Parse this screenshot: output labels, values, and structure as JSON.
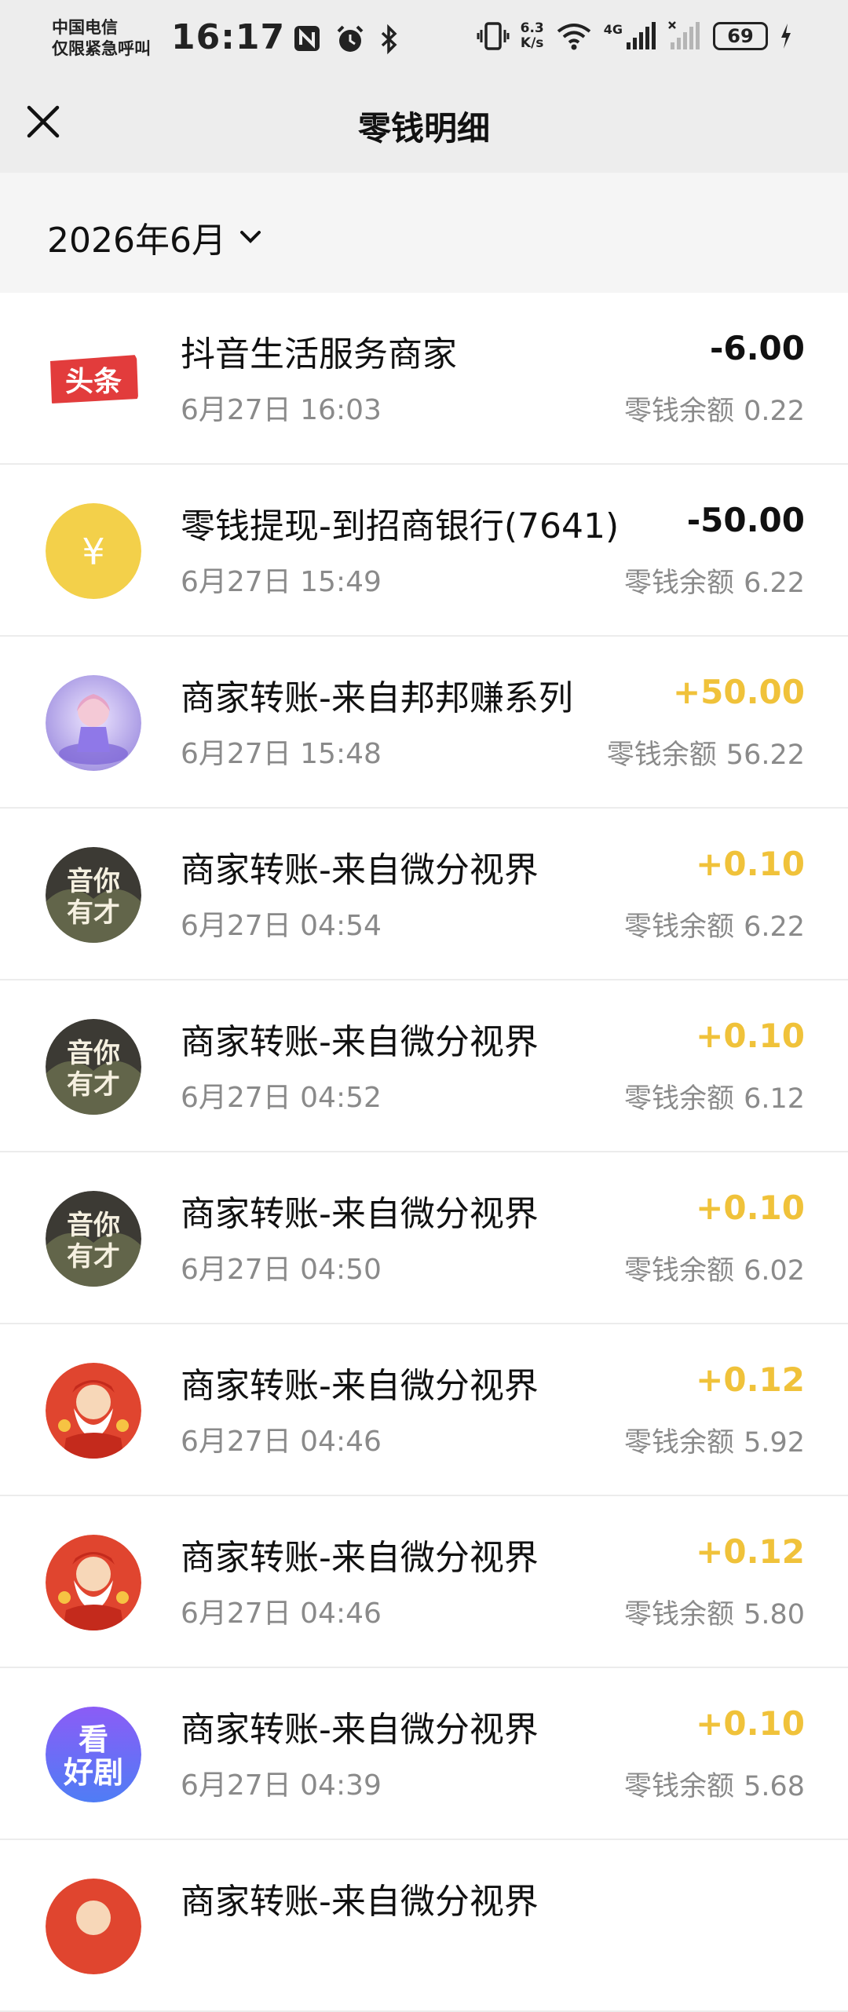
{
  "status_bar": {
    "carrier_line1": "中国电信",
    "carrier_line2": "仅限紧急呼叫",
    "time": "16:17",
    "net_speed_value": "6.3",
    "net_speed_unit": "K/s",
    "network_type": "4G",
    "battery": "69"
  },
  "header": {
    "title": "零钱明细"
  },
  "filter": {
    "month": "2026年6月"
  },
  "balance_label": "零钱余额",
  "colors": {
    "income": "#f0c23a",
    "expense": "#111111",
    "secondary_text": "#8a8a8a"
  },
  "transactions": [
    {
      "avatar": "toutiao-logo",
      "avatar_text": "头条",
      "title": "抖音生活服务商家",
      "time": "6月27日 16:03",
      "amount": "-6.00",
      "balance": "0.22",
      "type": "expense"
    },
    {
      "avatar": "yuan-coin",
      "avatar_text": "¥",
      "title": "零钱提现-到招商银行(7641)",
      "time": "6月27日 15:49",
      "amount": "-50.00",
      "balance": "6.22",
      "type": "expense"
    },
    {
      "avatar": "anime-girl-avatar",
      "avatar_text": "",
      "title": "商家转账-来自邦邦赚系列",
      "time": "6月27日 15:48",
      "amount": "+50.00",
      "balance": "56.22",
      "type": "income"
    },
    {
      "avatar": "yinniyoucai-logo",
      "avatar_text": "音你有才",
      "title": "商家转账-来自微分视界",
      "time": "6月27日 04:54",
      "amount": "+0.10",
      "balance": "6.22",
      "type": "income"
    },
    {
      "avatar": "yinniyoucai-logo",
      "avatar_text": "音你有才",
      "title": "商家转账-来自微分视界",
      "time": "6月27日 04:52",
      "amount": "+0.10",
      "balance": "6.12",
      "type": "income"
    },
    {
      "avatar": "yinniyoucai-logo",
      "avatar_text": "音你有才",
      "title": "商家转账-来自微分视界",
      "time": "6月27日 04:50",
      "amount": "+0.10",
      "balance": "6.02",
      "type": "income"
    },
    {
      "avatar": "god-of-wealth-avatar",
      "avatar_text": "",
      "title": "商家转账-来自微分视界",
      "time": "6月27日 04:46",
      "amount": "+0.12",
      "balance": "5.92",
      "type": "income"
    },
    {
      "avatar": "god-of-wealth-avatar",
      "avatar_text": "",
      "title": "商家转账-来自微分视界",
      "time": "6月27日 04:46",
      "amount": "+0.12",
      "balance": "5.80",
      "type": "income"
    },
    {
      "avatar": "kanhaoju-logo",
      "avatar_text": "看好剧",
      "title": "商家转账-来自微分视界",
      "time": "6月27日 04:39",
      "amount": "+0.10",
      "balance": "5.68",
      "type": "income"
    },
    {
      "avatar": "god-of-wealth-avatar",
      "avatar_text": "",
      "title": "商家转账-来自微分视界",
      "time": "",
      "amount": "",
      "balance": "",
      "type": "income"
    }
  ]
}
